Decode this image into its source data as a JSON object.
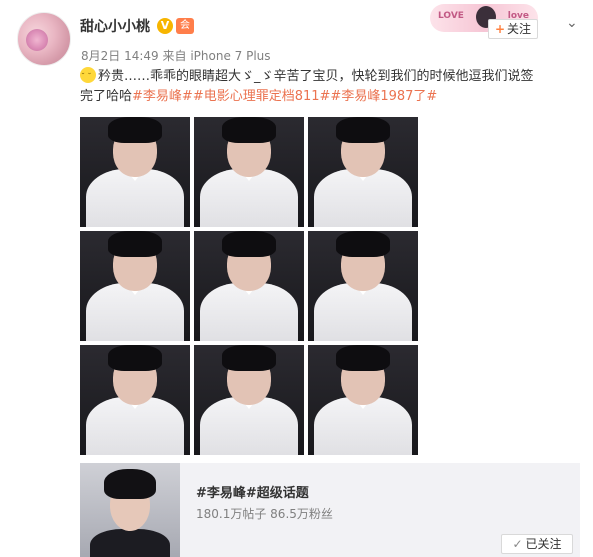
{
  "post": {
    "username": "甜心小小桃",
    "verified_icon": "V",
    "level_icon": "会",
    "timestamp": "8月2日 14:49",
    "source_prefix": "来自",
    "source": "iPhone 7 Plus",
    "follow_label": "关注",
    "banner_left": "LOVE",
    "banner_right": "love",
    "text_line1": "矜贵……乖乖的眼睛超大ゞ_ゞ辛苦了宝贝，快轮到我们的时候他逗我们说签",
    "text_line2_plain": "完了哈哈",
    "hashtags": [
      "#李易峰#",
      "#电影心理罪定档811#",
      "#李易峰1987了#"
    ]
  },
  "photos": [
    {
      "caption": ""
    },
    {
      "caption": ""
    },
    {
      "caption": ""
    },
    {
      "caption": ""
    },
    {
      "caption": ""
    },
    {
      "caption": ""
    },
    {
      "caption": ""
    },
    {
      "caption": ""
    },
    {
      "caption": ""
    }
  ],
  "topic_card": {
    "title": "#李易峰#超级话题",
    "stats": "180.1万帖子 86.5万粉丝",
    "followed_label": "已关注"
  },
  "colors": {
    "accent_orange": "#eb7350",
    "follow_plus": "#ff8140",
    "meta_gray": "#808080"
  }
}
